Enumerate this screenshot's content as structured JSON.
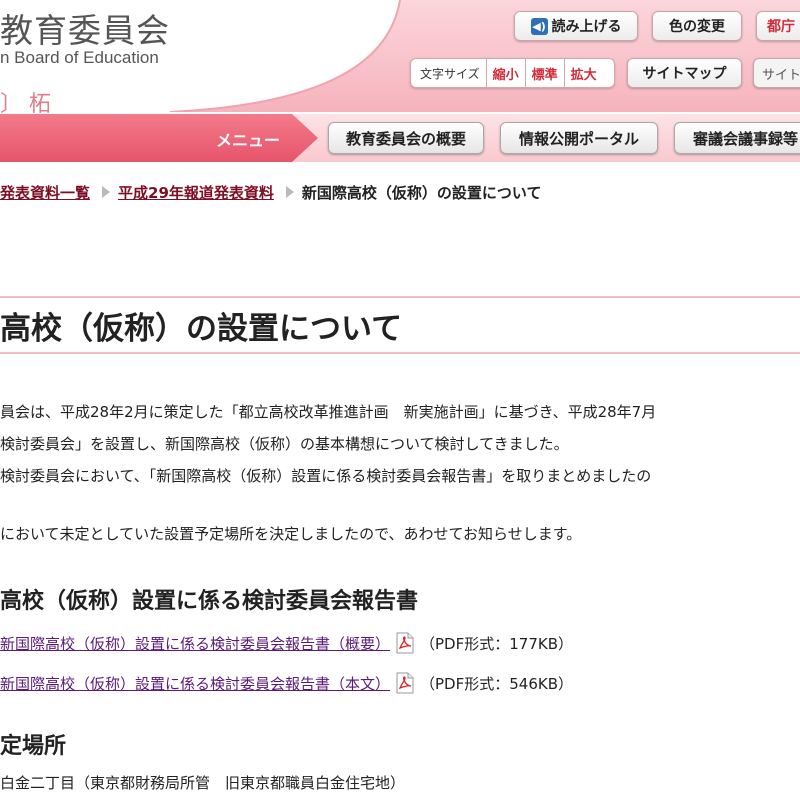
{
  "header": {
    "org_title": "教育委員会",
    "org_subtitle": "n Board of Education",
    "decorative_text": "〕 柘",
    "read_aloud_label": "読み上げる",
    "color_change_label": "色の変更",
    "tokyo_label": "都庁",
    "font_size_label": "文字サイズ",
    "font_size_options": [
      "縮小",
      "標準",
      "拡大"
    ],
    "sitemap_label": "サイトマップ",
    "site_search_label": "サイト",
    "colors": {
      "accent_pink": "#f08f9c",
      "link_red": "#d42b3b"
    }
  },
  "nav": {
    "menu_label": "メニュー",
    "items": [
      "教育委員会の概要",
      "情報公開ポータル",
      "審議会議事録等"
    ]
  },
  "breadcrumb": {
    "items": [
      "発表資料一覧",
      "平成29年報道発表資料"
    ],
    "current": "新国際高校（仮称）の設置について"
  },
  "main": {
    "title": "高校（仮称）の設置について",
    "paragraphs": [
      "員会は、平成28年2月に策定した「都立高校改革推進計画　新実施計画」に基づき、平成28年7月",
      "検討委員会」を設置し、新国際高校（仮称）の基本構想について検討してきました。",
      "検討委員会において、「新国際高校（仮称）設置に係る検討委員会報告書」を取りまとめましたの",
      "において未定としていた設置予定場所を決定しましたので、あわせてお知らせします。"
    ],
    "report_heading": "高校（仮称）設置に係る検討委員会報告書",
    "documents": [
      {
        "link": "新国際高校（仮称）設置に係る検討委員会報告書（概要）",
        "meta": "（PDF形式：177KB）"
      },
      {
        "link": "新国際高校（仮称）設置に係る検討委員会報告書（本文）",
        "meta": "（PDF形式：546KB）"
      }
    ],
    "location_heading": "定場所",
    "location_text": "白金二丁目（東京都財務局所管　旧東京都職員白金住宅地）"
  }
}
